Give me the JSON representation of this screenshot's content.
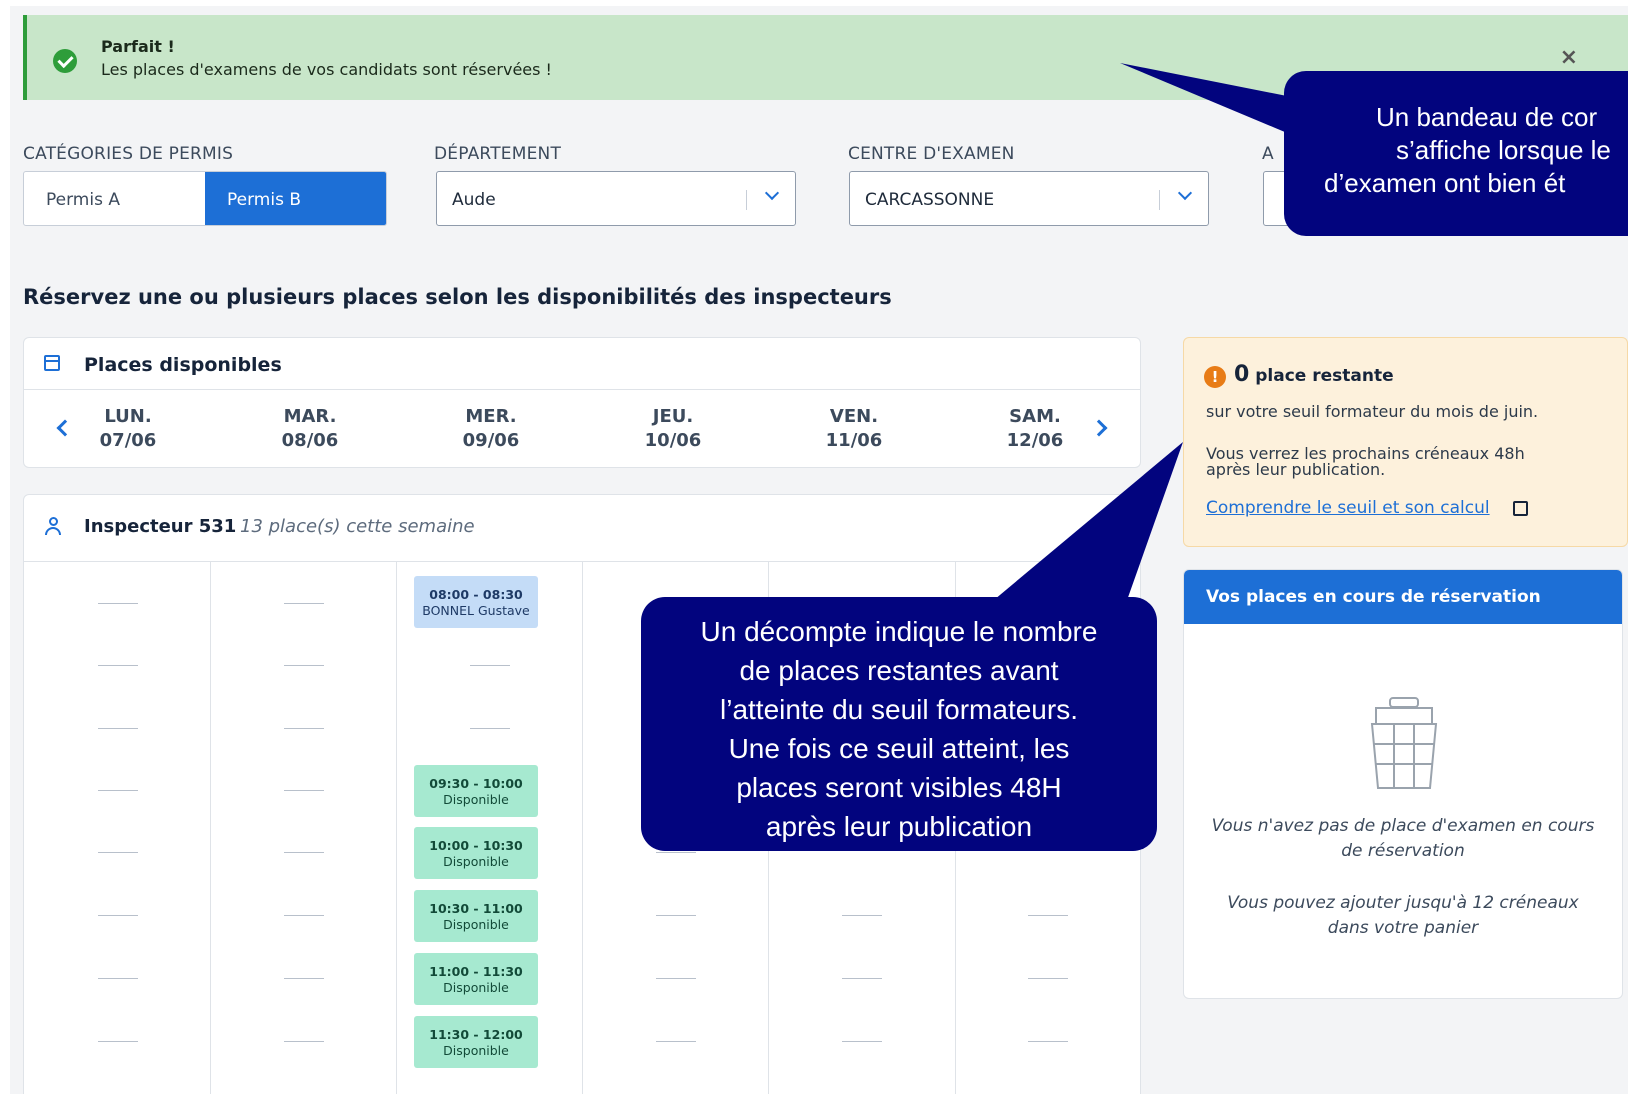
{
  "alert": {
    "title": "Parfait !",
    "message": "Les places d'examens de vos candidats sont réservées !",
    "close": "×"
  },
  "filters": {
    "categories_label": "CATÉGORIES DE PERMIS",
    "permis_a": "Permis A",
    "permis_b": "Permis B",
    "departement_label": "DÉPARTEMENT",
    "departement_value": "Aude",
    "centre_label": "CENTRE D'EXAMEN",
    "centre_value": "CARCASSONNE",
    "fourth_label": "A"
  },
  "heading": "Réservez une ou plusieurs places selon les disponibilités des inspecteurs",
  "places": {
    "title": "Places disponibles",
    "days": [
      {
        "name": "LUN.",
        "date": "07/06"
      },
      {
        "name": "MAR.",
        "date": "08/06"
      },
      {
        "name": "MER.",
        "date": "09/06"
      },
      {
        "name": "JEU.",
        "date": "10/06"
      },
      {
        "name": "VEN.",
        "date": "11/06"
      },
      {
        "name": "SAM.",
        "date": "12/06"
      }
    ]
  },
  "inspector": {
    "name": "Inspecteur 531",
    "week": "13 place(s) cette semaine",
    "slots": [
      {
        "time": "08:00 - 08:30",
        "label": "BONNEL Gustave",
        "status": "booked"
      },
      {
        "time": "09:30 - 10:00",
        "label": "Disponible",
        "status": "free"
      },
      {
        "time": "10:00 - 10:30",
        "label": "Disponible",
        "status": "free"
      },
      {
        "time": "10:30 - 11:00",
        "label": "Disponible",
        "status": "free"
      },
      {
        "time": "11:00 - 11:30",
        "label": "Disponible",
        "status": "free"
      },
      {
        "time": "11:30 - 12:00",
        "label": "Disponible",
        "status": "free"
      }
    ]
  },
  "remaining": {
    "count": "0",
    "label": "place restante",
    "line1": "sur votre seuil formateur du mois de juin.",
    "line2a": "Vous verrez les prochains créneaux 48h",
    "line2b": "après leur publication.",
    "link": "Comprendre le seuil et son calcul"
  },
  "reservation": {
    "title": "Vos places en cours de réservation",
    "empty1a": "Vous n'avez pas de place d'examen en cours",
    "empty1b": "de réservation",
    "empty2a": "Vous pouvez ajouter jusqu'à 12 créneaux",
    "empty2b": "dans votre panier"
  },
  "callouts": {
    "top": [
      "Un bandeau de cor",
      "s’affiche lorsque le",
      "d’examen ont bien ét"
    ],
    "middle": [
      "Un décompte indique le nombre",
      "de places restantes avant",
      "l’atteinte du seuil formateurs.",
      "Une fois ce seuil atteint, les",
      "places seront visibles 48H",
      "après leur publication"
    ]
  },
  "colors": {
    "accent": "#1d6fd6",
    "success": "#c8e6c9",
    "callout": "#02047e",
    "slot_free": "#a6e9d0",
    "slot_booked": "#c4dcf7",
    "warning": "#fdf1dc"
  }
}
